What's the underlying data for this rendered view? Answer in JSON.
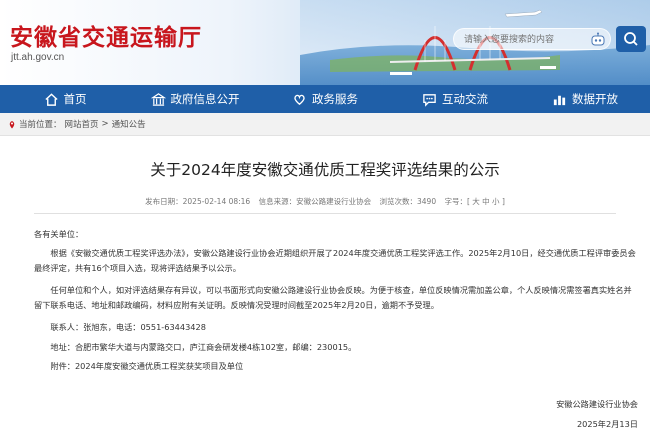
{
  "header": {
    "site_title": "安徽省交通运输厅",
    "site_domain": "jtt.ah.gov.cn",
    "search_placeholder": "请输入您要搜索的内容"
  },
  "nav": {
    "items": [
      {
        "label": "首页",
        "icon": "home-icon"
      },
      {
        "label": "政府信息公开",
        "icon": "building-icon"
      },
      {
        "label": "政务服务",
        "icon": "heart-hands-icon"
      },
      {
        "label": "互动交流",
        "icon": "chat-icon"
      },
      {
        "label": "数据开放",
        "icon": "bar-chart-icon"
      }
    ]
  },
  "breadcrumb": {
    "prefix": "当前位置：",
    "home": "网站首页",
    "separator": ">",
    "current": "通知公告"
  },
  "article": {
    "title": "关于2024年度安徽交通优质工程奖评选结果的公示",
    "date": "发布日期：2025-02-14 08:16",
    "source": "信息来源：安徽公路建设行业协会",
    "views": "浏览次数：3490",
    "font_size": "字号：[ 大 中 小 ]",
    "salutation": "各有关单位：",
    "p1": "根据《安徽交通优质工程奖评选办法》，安徽公路建设行业协会近期组织开展了2024年度交通优质工程奖评选工作。2025年2月10日，经交通优质工程评审委员会最终评定，共有16个项目入选，现将评选结果予以公示。",
    "p2": "任何单位和个人，如对评选结果存有异议，可以书面形式向安徽公路建设行业协会反映。为便于核查，单位反映情况需加盖公章，个人反映情况需签署真实姓名并留下联系电话、地址和邮政编码，材料应附有关证明。反映情况受理时间截至2025年2月20日，逾期不予受理。",
    "contact": "联系人：张旭东，电话：0551-63443428",
    "address": "地址：合肥市繁华大道与内蒙路交口，庐江商会研发楼4栋102室，邮编：230015。",
    "attachment": "附件：2024年度安徽交通优质工程奖获奖项目及单位",
    "signature": "安徽公路建设行业协会",
    "sign_date": "2025年2月13日"
  },
  "colors": {
    "brand_red": "#c8161d",
    "nav_blue": "#1f5fa8"
  }
}
